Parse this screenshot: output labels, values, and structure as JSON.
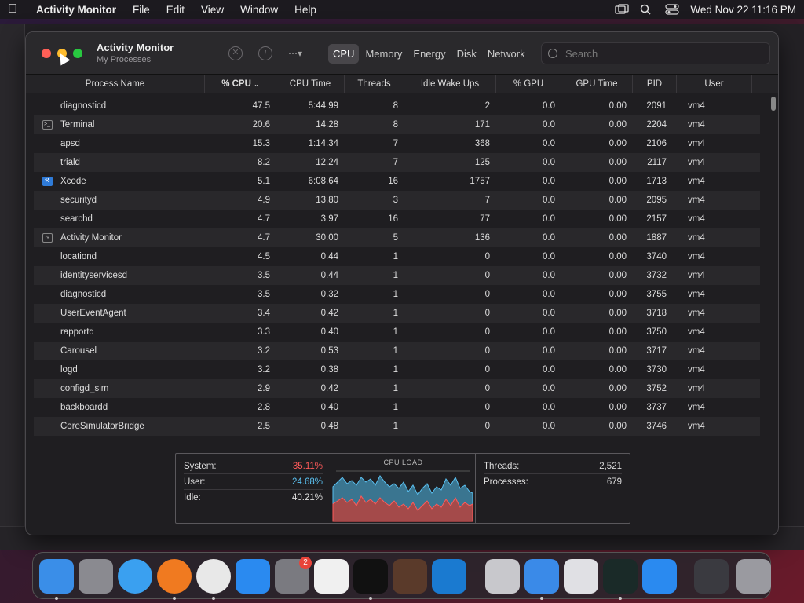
{
  "menubar": {
    "app": "Activity Monitor",
    "items": [
      "File",
      "Edit",
      "View",
      "Window",
      "Help"
    ],
    "datetime": "Wed Nov 22  11:16 PM"
  },
  "window": {
    "title": "Activity Monitor",
    "subtitle": "My Processes",
    "tabs": [
      "CPU",
      "Memory",
      "Energy",
      "Disk",
      "Network"
    ],
    "active_tab": "CPU",
    "search_placeholder": "Search"
  },
  "table": {
    "columns": [
      "Process Name",
      "% CPU",
      "CPU Time",
      "Threads",
      "Idle Wake Ups",
      "% GPU",
      "GPU Time",
      "PID",
      "User"
    ],
    "sort_column": "% CPU",
    "rows": [
      {
        "icon": "",
        "name": "diagnosticd",
        "cpu": "47.5",
        "time": "5:44.99",
        "threads": "8",
        "wake": "2",
        "gpu": "0.0",
        "gtime": "0.00",
        "pid": "2091",
        "user": "vm4"
      },
      {
        "icon": "terminal-icon",
        "name": "Terminal",
        "cpu": "20.6",
        "time": "14.28",
        "threads": "8",
        "wake": "171",
        "gpu": "0.0",
        "gtime": "0.00",
        "pid": "2204",
        "user": "vm4"
      },
      {
        "icon": "",
        "name": "apsd",
        "cpu": "15.3",
        "time": "1:14.34",
        "threads": "7",
        "wake": "368",
        "gpu": "0.0",
        "gtime": "0.00",
        "pid": "2106",
        "user": "vm4"
      },
      {
        "icon": "",
        "name": "triald",
        "cpu": "8.2",
        "time": "12.24",
        "threads": "7",
        "wake": "125",
        "gpu": "0.0",
        "gtime": "0.00",
        "pid": "2117",
        "user": "vm4"
      },
      {
        "icon": "xcode-icon",
        "name": "Xcode",
        "cpu": "5.1",
        "time": "6:08.64",
        "threads": "16",
        "wake": "1757",
        "gpu": "0.0",
        "gtime": "0.00",
        "pid": "1713",
        "user": "vm4"
      },
      {
        "icon": "",
        "name": "securityd",
        "cpu": "4.9",
        "time": "13.80",
        "threads": "3",
        "wake": "7",
        "gpu": "0.0",
        "gtime": "0.00",
        "pid": "2095",
        "user": "vm4"
      },
      {
        "icon": "",
        "name": "searchd",
        "cpu": "4.7",
        "time": "3.97",
        "threads": "16",
        "wake": "77",
        "gpu": "0.0",
        "gtime": "0.00",
        "pid": "2157",
        "user": "vm4"
      },
      {
        "icon": "activity-monitor-icon",
        "name": "Activity Monitor",
        "cpu": "4.7",
        "time": "30.00",
        "threads": "5",
        "wake": "136",
        "gpu": "0.0",
        "gtime": "0.00",
        "pid": "1887",
        "user": "vm4"
      },
      {
        "icon": "",
        "name": "locationd",
        "cpu": "4.5",
        "time": "0.44",
        "threads": "1",
        "wake": "0",
        "gpu": "0.0",
        "gtime": "0.00",
        "pid": "3740",
        "user": "vm4"
      },
      {
        "icon": "",
        "name": "identityservicesd",
        "cpu": "3.5",
        "time": "0.44",
        "threads": "1",
        "wake": "0",
        "gpu": "0.0",
        "gtime": "0.00",
        "pid": "3732",
        "user": "vm4"
      },
      {
        "icon": "",
        "name": "diagnosticd",
        "cpu": "3.5",
        "time": "0.32",
        "threads": "1",
        "wake": "0",
        "gpu": "0.0",
        "gtime": "0.00",
        "pid": "3755",
        "user": "vm4"
      },
      {
        "icon": "",
        "name": "UserEventAgent",
        "cpu": "3.4",
        "time": "0.42",
        "threads": "1",
        "wake": "0",
        "gpu": "0.0",
        "gtime": "0.00",
        "pid": "3718",
        "user": "vm4"
      },
      {
        "icon": "",
        "name": "rapportd",
        "cpu": "3.3",
        "time": "0.40",
        "threads": "1",
        "wake": "0",
        "gpu": "0.0",
        "gtime": "0.00",
        "pid": "3750",
        "user": "vm4"
      },
      {
        "icon": "",
        "name": "Carousel",
        "cpu": "3.2",
        "time": "0.53",
        "threads": "1",
        "wake": "0",
        "gpu": "0.0",
        "gtime": "0.00",
        "pid": "3717",
        "user": "vm4"
      },
      {
        "icon": "",
        "name": "logd",
        "cpu": "3.2",
        "time": "0.38",
        "threads": "1",
        "wake": "0",
        "gpu": "0.0",
        "gtime": "0.00",
        "pid": "3730",
        "user": "vm4"
      },
      {
        "icon": "",
        "name": "configd_sim",
        "cpu": "2.9",
        "time": "0.42",
        "threads": "1",
        "wake": "0",
        "gpu": "0.0",
        "gtime": "0.00",
        "pid": "3752",
        "user": "vm4"
      },
      {
        "icon": "",
        "name": "backboardd",
        "cpu": "2.8",
        "time": "0.40",
        "threads": "1",
        "wake": "0",
        "gpu": "0.0",
        "gtime": "0.00",
        "pid": "3737",
        "user": "vm4"
      },
      {
        "icon": "",
        "name": "CoreSimulatorBridge",
        "cpu": "2.5",
        "time": "0.48",
        "threads": "1",
        "wake": "0",
        "gpu": "0.0",
        "gtime": "0.00",
        "pid": "3746",
        "user": "vm4"
      }
    ]
  },
  "summary": {
    "system_label": "System:",
    "system_value": "35.11%",
    "user_label": "User:",
    "user_value": "24.68%",
    "idle_label": "Idle:",
    "idle_value": "40.21%",
    "cpuload_title": "CPU LOAD",
    "threads_label": "Threads:",
    "threads_value": "2,521",
    "processes_label": "Processes:",
    "processes_value": "679"
  },
  "colors": {
    "system": "#ff5a5a",
    "user": "#5ac0f0",
    "accent": "#2f7bd8"
  },
  "dock": {
    "apps": [
      "finder-icon",
      "launchpad-icon",
      "safari-icon",
      "firefox-icon",
      "chrome-icon",
      "app-store-icon",
      "system-settings-icon",
      "textedit-icon",
      "terminal-icon",
      "instruments-icon",
      "vscode-icon",
      "installer-icon",
      "xcode-icon",
      "simulator-icon",
      "activity-monitor-icon",
      "app-store-2-icon",
      "downloads-icon",
      "trash-icon"
    ],
    "settings_badge": "2"
  }
}
